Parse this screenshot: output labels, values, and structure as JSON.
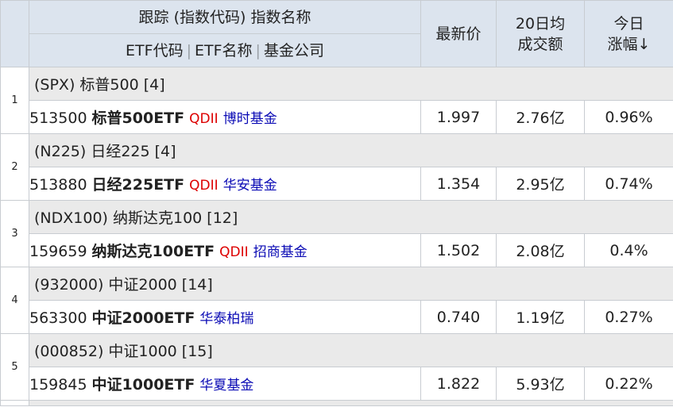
{
  "header": {
    "top_title": "跟踪 (指数代码) 指数名称",
    "sub_etf_code": "ETF代码",
    "sub_etf_name": "ETF名称",
    "sub_company": "基金公司",
    "separator": "|",
    "latest_price": "最新价",
    "avg_volume_line1": "20日均",
    "avg_volume_line2": "成交额",
    "change_line1": "今日",
    "change_line2": "涨幅↓"
  },
  "rows": [
    {
      "rank": "1",
      "index_label": "(SPX) 标普500 [4]",
      "code": "513500",
      "name": "标普500ETF",
      "qdii": "QDII",
      "company": "博时基金",
      "price": "1.997",
      "volume": "2.76亿",
      "change": "0.96%"
    },
    {
      "rank": "2",
      "index_label": "(N225) 日经225 [4]",
      "code": "513880",
      "name": "日经225ETF",
      "qdii": "QDII",
      "company": "华安基金",
      "price": "1.354",
      "volume": "2.95亿",
      "change": "0.74%"
    },
    {
      "rank": "3",
      "index_label": "(NDX100) 纳斯达克100 [12]",
      "code": "159659",
      "name": "纳斯达克100ETF",
      "qdii": "QDII",
      "company": "招商基金",
      "price": "1.502",
      "volume": "2.08亿",
      "change": "0.4%"
    },
    {
      "rank": "4",
      "index_label": "(932000) 中证2000 [14]",
      "code": "563300",
      "name": "中证2000ETF",
      "qdii": "",
      "company": "华泰柏瑞",
      "price": "0.740",
      "volume": "1.19亿",
      "change": "0.27%"
    },
    {
      "rank": "5",
      "index_label": "(000852) 中证1000 [15]",
      "code": "159845",
      "name": "中证1000ETF",
      "qdii": "",
      "company": "华夏基金",
      "price": "1.822",
      "volume": "5.93亿",
      "change": "0.22%"
    }
  ],
  "colors": {
    "header_bg": "#dce4ee",
    "index_row_bg": "#eaeaea",
    "qdii": "#dd0000",
    "company": "#0b0bb5"
  }
}
